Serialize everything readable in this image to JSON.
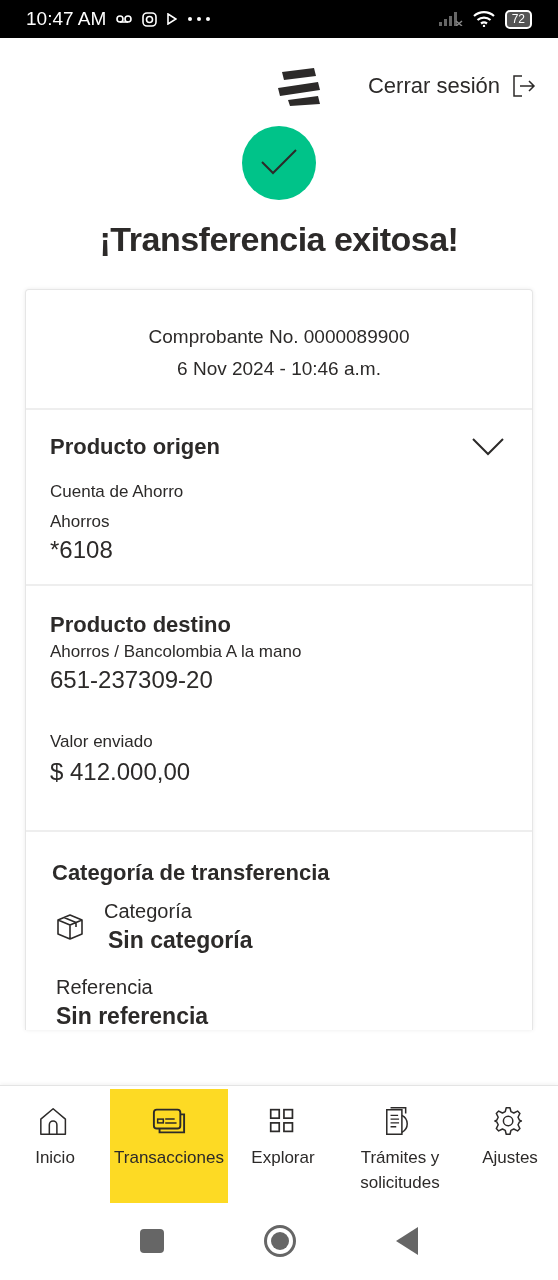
{
  "status_bar": {
    "time": "10:47 AM",
    "battery": "72"
  },
  "header": {
    "logout": "Cerrar sesión"
  },
  "title": "¡Transferencia exitosa!",
  "receipt": {
    "number": "Comprobante No. 0000089900",
    "datetime": "6 Nov 2024 - 10:46 a.m."
  },
  "origin": {
    "title": "Producto origen",
    "expanded": false,
    "type": "Cuenta de Ahorro",
    "subtype": "Ahorros",
    "account": "*6108"
  },
  "destination": {
    "title": "Producto destino",
    "description": "Ahorros / Bancolombia A la mano",
    "account": "651-237309-20",
    "amount_label": "Valor enviado",
    "amount": "$ 412.000,00"
  },
  "category": {
    "title": "Categoría de transferencia",
    "category_label": "Categoría",
    "category_value": "Sin categoría",
    "reference_label": "Referencia",
    "reference_value": "Sin referencia"
  },
  "nav": {
    "items": [
      {
        "kind": "home",
        "label": "Inicio",
        "selected": false
      },
      {
        "kind": "cards",
        "label": "Transacciones",
        "selected": true
      },
      {
        "kind": "grid",
        "label": "Explorar",
        "selected": false
      },
      {
        "kind": "docs",
        "label": "Trámites y solicitudes",
        "selected": false
      },
      {
        "kind": "gear",
        "label": "Ajustes",
        "selected": false
      }
    ]
  }
}
